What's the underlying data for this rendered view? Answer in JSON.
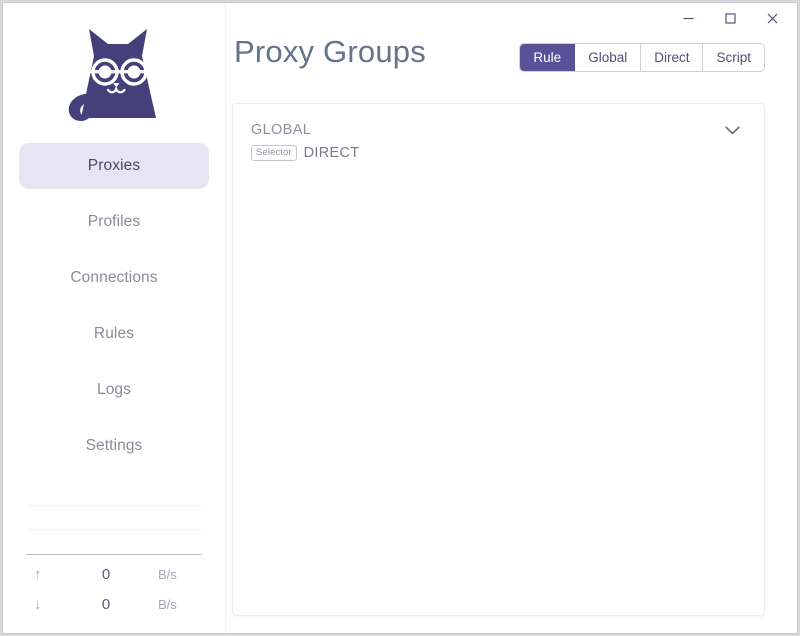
{
  "window": {
    "controls": [
      {
        "name": "minimize",
        "glyph": "minimize-icon"
      },
      {
        "name": "maximize",
        "glyph": "maximize-icon"
      },
      {
        "name": "close",
        "glyph": "close-icon"
      }
    ]
  },
  "brand": {
    "logo_name": "clash-cat-logo",
    "logo_color": "#46407a"
  },
  "sidebar": {
    "items": [
      {
        "label": "Proxies",
        "active": true
      },
      {
        "label": "Profiles",
        "active": false
      },
      {
        "label": "Connections",
        "active": false
      },
      {
        "label": "Rules",
        "active": false
      },
      {
        "label": "Logs",
        "active": false
      },
      {
        "label": "Settings",
        "active": false
      }
    ],
    "traffic": {
      "upload": {
        "arrow": "↑",
        "value": "0",
        "unit": "B/s"
      },
      "download": {
        "arrow": "↓",
        "value": "0",
        "unit": "B/s"
      }
    }
  },
  "header": {
    "title": "Proxy Groups",
    "modes": [
      {
        "label": "Rule",
        "active": true
      },
      {
        "label": "Global",
        "active": false
      },
      {
        "label": "Direct",
        "active": false
      },
      {
        "label": "Script",
        "active": false
      }
    ]
  },
  "main": {
    "groups": [
      {
        "name": "GLOBAL",
        "type_badge": "Selector",
        "current": "DIRECT",
        "expanded": false
      }
    ]
  },
  "colors": {
    "accent": "#5a5299",
    "accent_soft": "#e7e5f1",
    "title": "#64748b",
    "muted": "#8f8f9c",
    "logo": "#46407a"
  }
}
